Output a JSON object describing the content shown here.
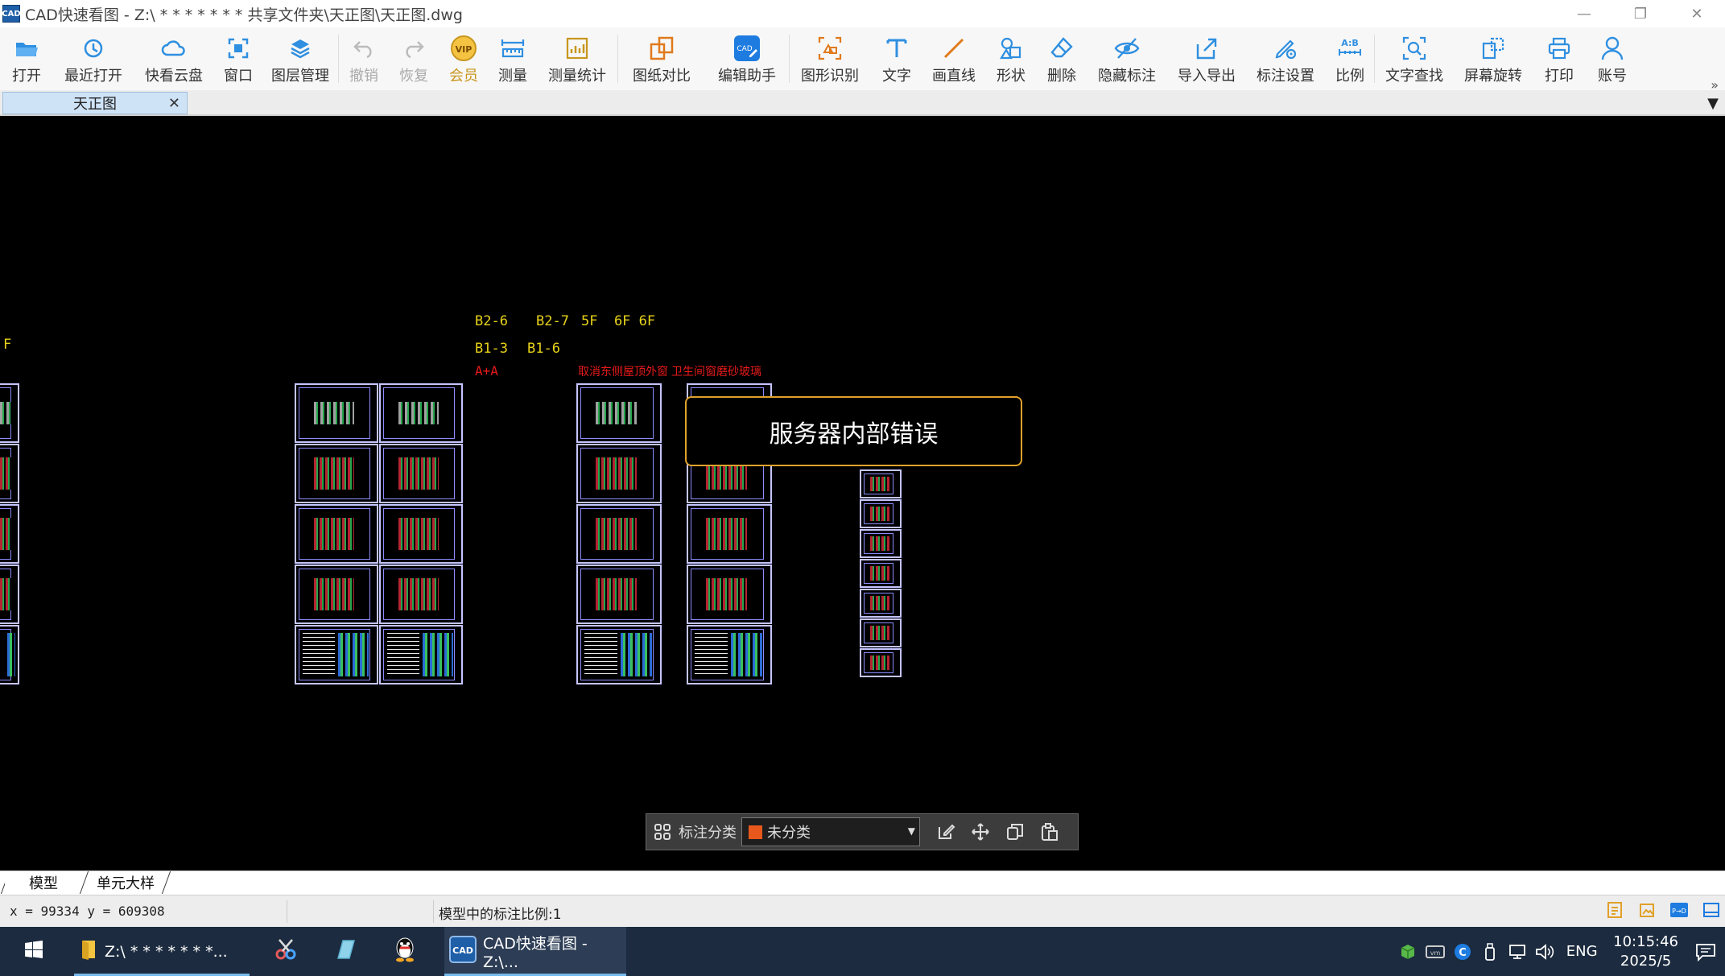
{
  "window": {
    "logo_text": "CAD",
    "title": "CAD快速看图 - Z:\\ * * * * * * * 共享文件夹\\天正图\\天正图.dwg",
    "controls": [
      "minimize",
      "restore",
      "close"
    ]
  },
  "toolbar": {
    "items": [
      {
        "label": "打开",
        "icon": "folder-open-icon",
        "state": "normal"
      },
      {
        "label": "最近打开",
        "icon": "history-icon",
        "state": "normal"
      },
      {
        "label": "快看云盘",
        "icon": "cloud-icon",
        "state": "normal"
      },
      {
        "label": "窗口",
        "icon": "window-fit-icon",
        "state": "normal"
      },
      {
        "label": "图层管理",
        "icon": "layers-icon",
        "state": "normal"
      },
      {
        "label": "撤销",
        "icon": "undo-icon",
        "state": "disabled"
      },
      {
        "label": "恢复",
        "icon": "redo-icon",
        "state": "disabled"
      },
      {
        "label": "会员",
        "icon": "vip-icon",
        "state": "vip",
        "badge": "VIP"
      },
      {
        "label": "测量",
        "icon": "ruler-icon",
        "state": "normal"
      },
      {
        "label": "测量统计",
        "icon": "measure-stats-icon",
        "state": "normal"
      },
      {
        "label": "图纸对比",
        "icon": "compare-icon",
        "state": "normal"
      },
      {
        "label": "编辑助手",
        "icon": "edit-assistant-icon",
        "state": "normal"
      },
      {
        "label": "图形识别",
        "icon": "shape-recognition-icon",
        "state": "normal"
      },
      {
        "label": "文字",
        "icon": "text-icon",
        "state": "normal"
      },
      {
        "label": "画直线",
        "icon": "line-icon",
        "state": "normal"
      },
      {
        "label": "形状",
        "icon": "shapes-icon",
        "state": "normal"
      },
      {
        "label": "删除",
        "icon": "eraser-icon",
        "state": "normal"
      },
      {
        "label": "隐藏标注",
        "icon": "eye-hide-icon",
        "state": "normal"
      },
      {
        "label": "导入导出",
        "icon": "import-export-icon",
        "state": "normal"
      },
      {
        "label": "标注设置",
        "icon": "annotation-settings-icon",
        "state": "normal"
      },
      {
        "label": "比例",
        "icon": "scale-icon",
        "state": "normal",
        "badge": "A:B"
      },
      {
        "label": "文字查找",
        "icon": "text-search-icon",
        "state": "normal"
      },
      {
        "label": "屏幕旋转",
        "icon": "screen-rotate-icon",
        "state": "normal"
      },
      {
        "label": "打印",
        "icon": "printer-icon",
        "state": "normal"
      },
      {
        "label": "账号",
        "icon": "user-icon",
        "state": "normal"
      }
    ],
    "more": "»"
  },
  "tabs": {
    "document_tab": "天正图",
    "close": "✕",
    "dropdown": "▼"
  },
  "canvas": {
    "labels": {
      "f_left": "F",
      "b2_6": "B2-6",
      "b2_7": "B2-7",
      "floors": "5F  6F 6F",
      "b1_3": "B1-3",
      "b1_6": "B1-6",
      "a_a": "A+A",
      "note1": "取消东侧屋顶外窗",
      "note2": "卫生间窗磨砂玻璃"
    },
    "error_message": "服务器内部错误"
  },
  "annotation_bar": {
    "label": "标注分类",
    "selected": "未分类",
    "swatch_color": "#e8581c",
    "actions": [
      "edit-annotation-icon",
      "move-icon",
      "copy-icon",
      "paste-icon"
    ]
  },
  "layout_tabs": [
    "模型",
    "单元大样"
  ],
  "status": {
    "coords": "x = 99334  y = 609308",
    "scale_text": "模型中的标注比例:1"
  },
  "taskbar": {
    "explorer_label": "Z:\\ * * * * * * *...",
    "cad_label": "CAD快速看图 - Z:\\...",
    "lang": "ENG",
    "time": "10:15:46",
    "date": "2025/5"
  }
}
